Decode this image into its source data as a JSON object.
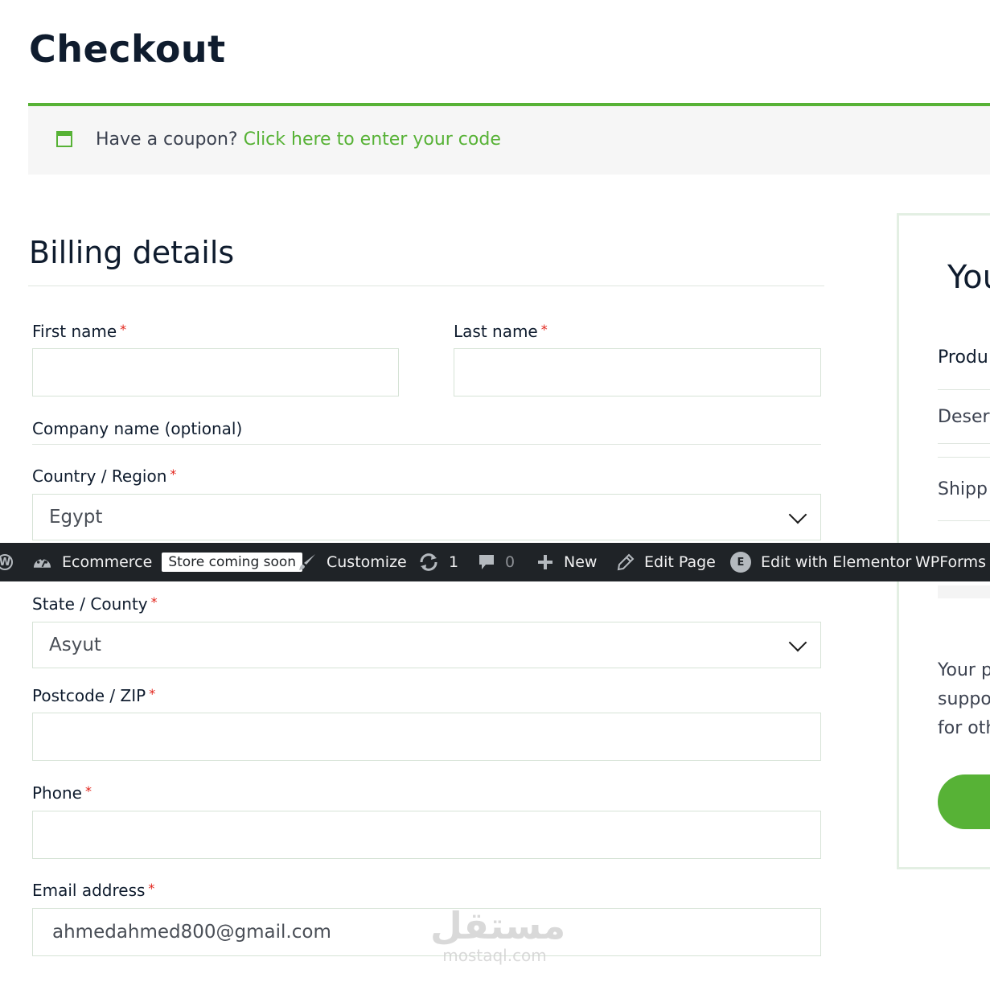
{
  "page": {
    "title": "Checkout"
  },
  "coupon": {
    "prompt": "Have a coupon?",
    "link": "Click here to enter your code"
  },
  "billing": {
    "title": "Billing details",
    "fields": {
      "first_name": {
        "label": "First name",
        "required": "*",
        "value": ""
      },
      "last_name": {
        "label": "Last name",
        "required": "*",
        "value": ""
      },
      "company": {
        "label": "Company name (optional)"
      },
      "country": {
        "label": "Country / Region",
        "required": "*",
        "value": "Egypt"
      },
      "state": {
        "label": "State / County",
        "required": "*",
        "value": "Asyut"
      },
      "postcode": {
        "label": "Postcode / ZIP",
        "required": "*",
        "value": ""
      },
      "phone": {
        "label": "Phone",
        "required": "*",
        "value": ""
      },
      "email": {
        "label": "Email address",
        "required": "*",
        "value": "ahmedahmed800@gmail.com"
      }
    }
  },
  "admin_bar": {
    "site": "Ecommerce",
    "badge": "Store coming soon",
    "customize": "Customize",
    "updates": "1",
    "comments": "0",
    "new": "New",
    "edit_page": "Edit Page",
    "edit_elementor": "Edit with Elementor",
    "wpforms": "WPForms",
    "icons": [
      "wordpress-logo-icon",
      "dashboard-icon",
      "brush-icon",
      "refresh-icon",
      "comment-icon",
      "plus-icon",
      "pencil-icon",
      "elementor-icon"
    ]
  },
  "order": {
    "title": "You",
    "product_header": "Produ",
    "item": "Deser",
    "shipping": "Shipp",
    "privacy": [
      "Your p",
      "suppo",
      "for oth"
    ]
  },
  "watermark": {
    "arabic": "مستقل",
    "latin": "mostaql.com"
  },
  "colors": {
    "accent": "#57b236",
    "required": "#e2231a",
    "admin_bar": "#1f2327",
    "text": "#0f1c2e"
  }
}
